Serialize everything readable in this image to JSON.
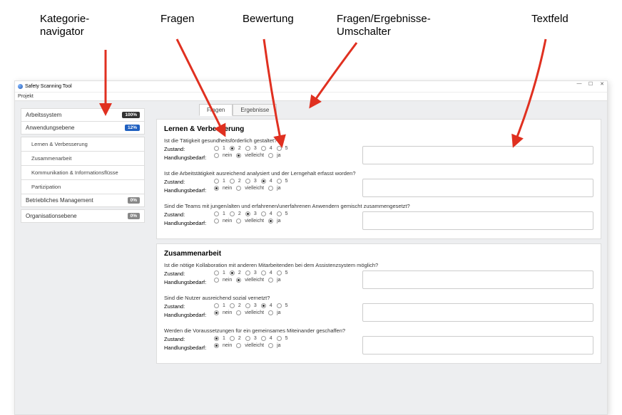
{
  "annotations": {
    "kategorie": "Kategorie-\nnavigator",
    "fragen": "Fragen",
    "bewertung": "Bewertung",
    "umschalter": "Fragen/Ergebnisse-\nUmschalter",
    "textfeld": "Textfeld"
  },
  "window": {
    "title": "Safety Scanning Tool",
    "menu_projekt": "Projekt"
  },
  "sidebar": {
    "items": [
      {
        "label": "Arbeitssystem",
        "badge": "100%",
        "badgeClass": "badge-dark"
      },
      {
        "label": "Anwendungsebene",
        "badge": "12%",
        "badgeClass": "badge-blue"
      }
    ],
    "subs": [
      "Lernen & Verbesserung",
      "Zusammenarbeit",
      "Kommunikation & Informationsflüsse",
      "Partizipation"
    ],
    "items2": [
      {
        "label": "Betriebliches Management",
        "badge": "0%",
        "badgeClass": "badge-grey"
      },
      {
        "label": "Organisationsebene",
        "badge": "0%",
        "badgeClass": "badge-grey"
      }
    ]
  },
  "tabs": {
    "fragen": "Fragen",
    "ergebnisse": "Ergebnisse"
  },
  "labels": {
    "zustand": "Zustand:",
    "handlungsbedarf": "Handlungsbedarf:",
    "radios15": [
      "1",
      "2",
      "3",
      "4",
      "5"
    ],
    "radiosNVJ": [
      "nein",
      "vielleicht",
      "ja"
    ]
  },
  "sections": [
    {
      "title": "Lernen & Verbesserung",
      "questions": [
        {
          "text": "Ist die Tätigkeit gesundheitsförderlich gestaltet?",
          "zustand_sel": 1,
          "hb_sel": 1
        },
        {
          "text": "Ist die Arbeitstätigkeit ausreichend analysiert und der Lerngehalt erfasst worden?",
          "zustand_sel": 3,
          "hb_sel": 0
        },
        {
          "text": "Sind die Teams mit jungen/alten und erfahrenen/unerfahrenen Anwendern gemischt zusammengesetzt?",
          "zustand_sel": 2,
          "hb_sel": 2
        }
      ]
    },
    {
      "title": "Zusammenarbeit",
      "questions": [
        {
          "text": "Ist die nötige Kollaboration mit anderen Mitarbeitenden bei dem Assistenzsystem möglich?",
          "zustand_sel": 1,
          "hb_sel": 1
        },
        {
          "text": "Sind die Nutzer ausreichend sozial vernetzt?",
          "zustand_sel": 3,
          "hb_sel": 0
        },
        {
          "text": "Werden die Voraussetzungen für ein gemeinsames Miteinander geschaffen?",
          "zustand_sel": 0,
          "hb_sel": 0
        }
      ]
    }
  ]
}
